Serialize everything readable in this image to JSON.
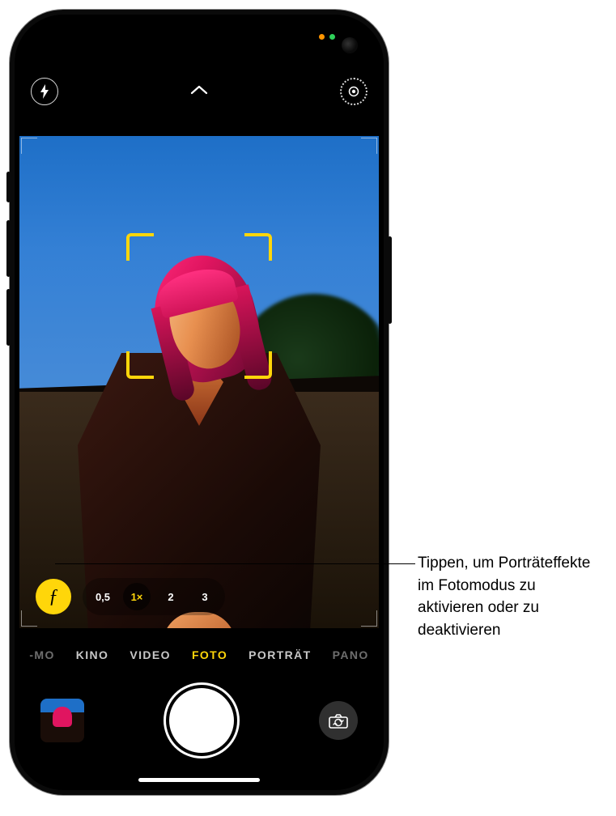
{
  "camera": {
    "zoom_levels": [
      "0,5",
      "1×",
      "2",
      "3"
    ],
    "zoom_selected_index": 1,
    "modes": [
      "-MO",
      "KINO",
      "VIDEO",
      "FOTO",
      "PORTRÄT",
      "PANO"
    ],
    "mode_selected_index": 3,
    "depth_button_glyph": "ƒ"
  },
  "callout": {
    "text": "Tippen, um Porträteffekte im Fotomodus zu aktivieren oder zu deaktivieren"
  }
}
